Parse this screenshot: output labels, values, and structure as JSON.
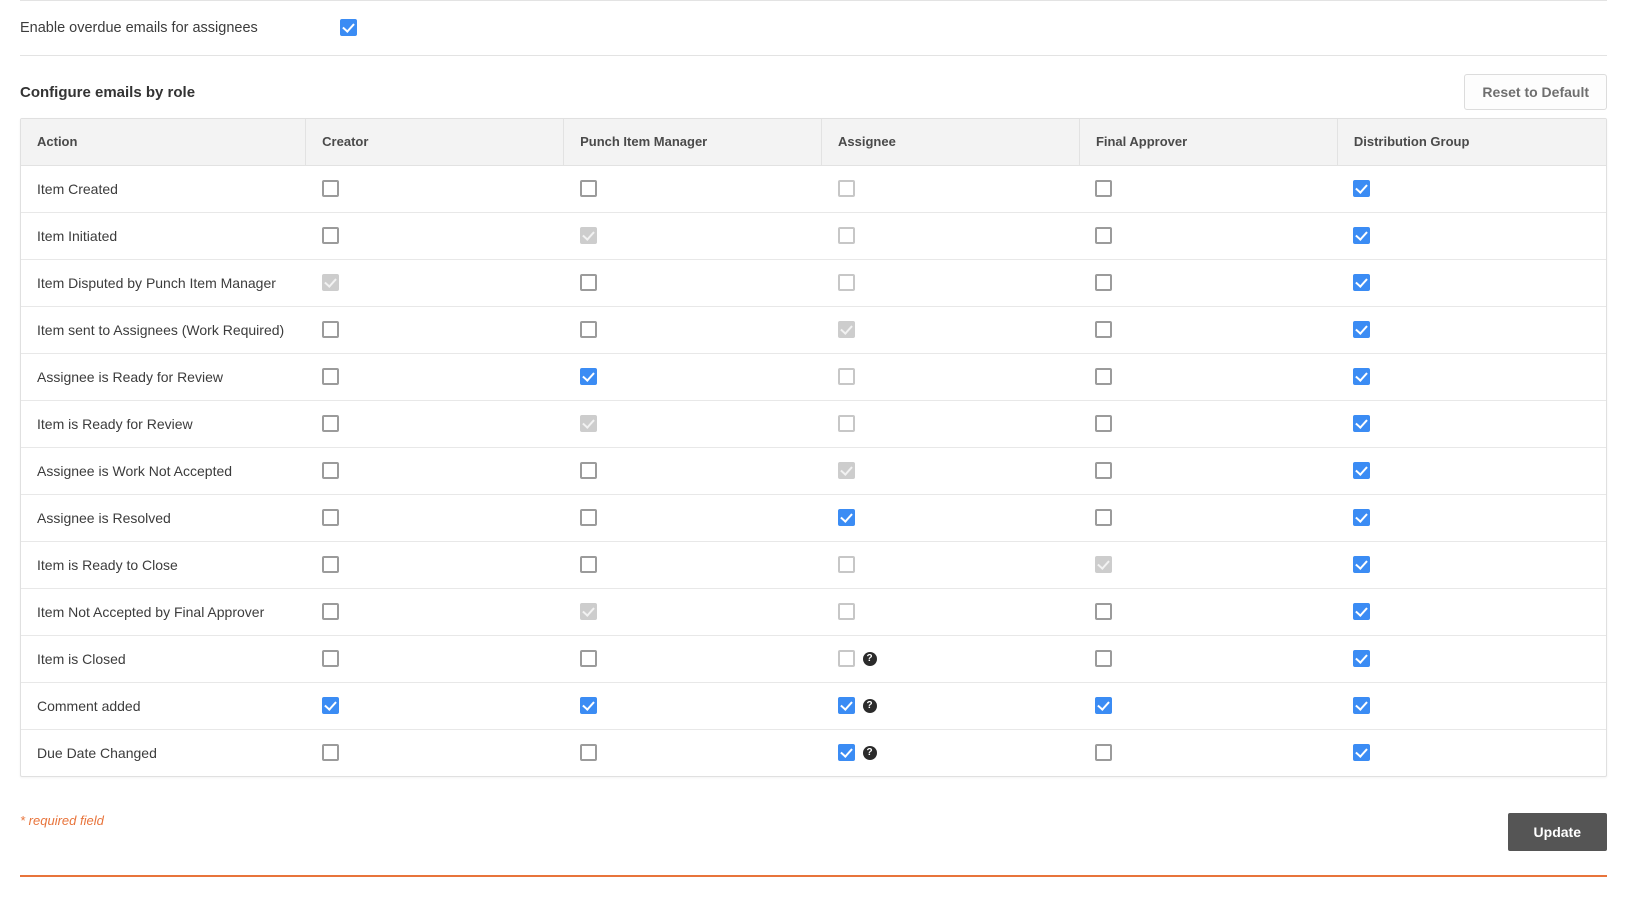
{
  "overdue_setting": {
    "label": "Enable overdue emails for assignees",
    "checked": true
  },
  "section": {
    "title": "Configure emails by role",
    "reset_button": "Reset to Default"
  },
  "table": {
    "columns": [
      "Action",
      "Creator",
      "Punch Item Manager",
      "Assignee",
      "Final Approver",
      "Distribution Group"
    ],
    "rows": [
      {
        "action": "Item Created",
        "states": [
          "off",
          "off",
          "off-light",
          "off",
          "on"
        ],
        "help": [
          false,
          false,
          false,
          false,
          false
        ]
      },
      {
        "action": "Item Initiated",
        "states": [
          "off",
          "disabled",
          "off-light",
          "off",
          "on"
        ],
        "help": [
          false,
          false,
          false,
          false,
          false
        ]
      },
      {
        "action": "Item Disputed by Punch Item Manager",
        "states": [
          "disabled",
          "off",
          "off-light",
          "off",
          "on"
        ],
        "help": [
          false,
          false,
          false,
          false,
          false
        ]
      },
      {
        "action": "Item sent to Assignees (Work Required)",
        "states": [
          "off",
          "off",
          "disabled",
          "off",
          "on"
        ],
        "help": [
          false,
          false,
          false,
          false,
          false
        ]
      },
      {
        "action": "Assignee is Ready for Review",
        "states": [
          "off",
          "on",
          "off-light",
          "off",
          "on"
        ],
        "help": [
          false,
          false,
          false,
          false,
          false
        ]
      },
      {
        "action": "Item is Ready for Review",
        "states": [
          "off",
          "disabled",
          "off-light",
          "off",
          "on"
        ],
        "help": [
          false,
          false,
          false,
          false,
          false
        ]
      },
      {
        "action": "Assignee is Work Not Accepted",
        "states": [
          "off",
          "off",
          "disabled",
          "off",
          "on"
        ],
        "help": [
          false,
          false,
          false,
          false,
          false
        ]
      },
      {
        "action": "Assignee is Resolved",
        "states": [
          "off",
          "off",
          "on",
          "off",
          "on"
        ],
        "help": [
          false,
          false,
          false,
          false,
          false
        ]
      },
      {
        "action": "Item is Ready to Close",
        "states": [
          "off",
          "off",
          "off-light",
          "disabled",
          "on"
        ],
        "help": [
          false,
          false,
          false,
          false,
          false
        ]
      },
      {
        "action": "Item Not Accepted by Final Approver",
        "states": [
          "off",
          "disabled",
          "off-light",
          "off",
          "on"
        ],
        "help": [
          false,
          false,
          false,
          false,
          false
        ]
      },
      {
        "action": "Item is Closed",
        "states": [
          "off",
          "off",
          "off-light",
          "off",
          "on"
        ],
        "help": [
          false,
          false,
          true,
          false,
          false
        ]
      },
      {
        "action": "Comment added",
        "states": [
          "on",
          "on",
          "on",
          "on",
          "on"
        ],
        "help": [
          false,
          false,
          true,
          false,
          false
        ]
      },
      {
        "action": "Due Date Changed",
        "states": [
          "off",
          "off",
          "on",
          "off",
          "on"
        ],
        "help": [
          false,
          false,
          true,
          false,
          false
        ]
      }
    ]
  },
  "footer": {
    "required_note": "* required field",
    "update_button": "Update"
  },
  "icons": {
    "help": "?"
  },
  "colors": {
    "checkbox_checked": "#3b8cf4",
    "checkbox_disabled": "#cdcdcd",
    "required_text": "#e8743b",
    "update_button_bg": "#555555",
    "accent_rule": "#e8743b"
  }
}
